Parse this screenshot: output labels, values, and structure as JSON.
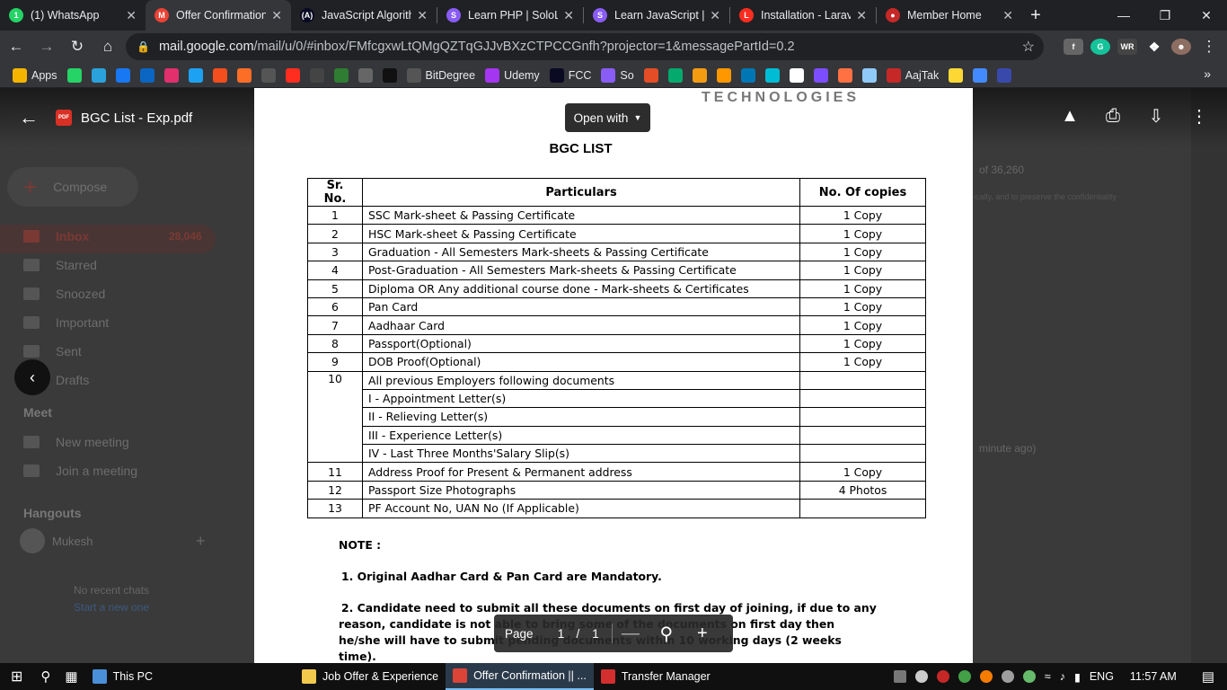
{
  "tabs": [
    {
      "title": "(1) WhatsApp",
      "icon": "whatsapp-icon",
      "color": "#25d366",
      "glyph": "1"
    },
    {
      "title": "Offer Confirmation",
      "icon": "gmail-icon",
      "color": "#ea4335",
      "glyph": "M"
    },
    {
      "title": "JavaScript Algorith",
      "icon": "fcc-icon",
      "color": "#0a0a23",
      "glyph": "(A)"
    },
    {
      "title": "Learn PHP | SoloLe",
      "icon": "sololearn-icon",
      "color": "#8a5cf6",
      "glyph": "S"
    },
    {
      "title": "Learn JavaScript | S",
      "icon": "sololearn-icon",
      "color": "#8a5cf6",
      "glyph": "S"
    },
    {
      "title": "Installation - Larav",
      "icon": "laravel-icon",
      "color": "#ff2d20",
      "glyph": "L"
    },
    {
      "title": "Member Home",
      "icon": "member-icon",
      "color": "#c62828",
      "glyph": "●"
    }
  ],
  "address_bar": {
    "domain": "mail.google.com",
    "path": "/mail/u/0/#inbox/FMfcgxwLtQMgQZTqGJJvBXzCTPCCGnfh?projector=1&messagePartId=0.2"
  },
  "bookmarks": [
    {
      "label": "Apps",
      "icon": "apps-grid-icon",
      "color": "#f4b400"
    },
    {
      "label": "",
      "icon": "whatsapp-icon",
      "color": "#25d366"
    },
    {
      "label": "",
      "icon": "telegram-icon",
      "color": "#2aa1da"
    },
    {
      "label": "",
      "icon": "facebook-icon",
      "color": "#1877f2"
    },
    {
      "label": "",
      "icon": "linkedin-icon",
      "color": "#0a66c2"
    },
    {
      "label": "",
      "icon": "instagram-icon",
      "color": "#e1306c"
    },
    {
      "label": "",
      "icon": "twitter-icon",
      "color": "#1da1f2"
    },
    {
      "label": "",
      "icon": "figma-icon",
      "color": "#f24e1e"
    },
    {
      "label": "",
      "icon": "gitlab-icon",
      "color": "#fc6d26"
    },
    {
      "label": "",
      "icon": "github-icon",
      "color": "#555555"
    },
    {
      "label": "",
      "icon": "laravel-icon",
      "color": "#ff2d20"
    },
    {
      "label": "",
      "icon": "codepen-icon",
      "color": "#444444"
    },
    {
      "label": "",
      "icon": "wix-icon",
      "color": "#2e7d32"
    },
    {
      "label": "",
      "icon": "cc-icon",
      "color": "#666666"
    },
    {
      "label": "",
      "icon": "hashnode-icon",
      "color": "#111111"
    },
    {
      "label": "BitDegree",
      "icon": "bitdegree-icon",
      "color": "#555555"
    },
    {
      "label": "Udemy",
      "icon": "udemy-icon",
      "color": "#a435f0"
    },
    {
      "label": "FCC",
      "icon": "fcc-icon",
      "color": "#0a0a23"
    },
    {
      "label": "So",
      "icon": "sololearn-icon",
      "color": "#8a5cf6"
    },
    {
      "label": "",
      "icon": "w-icon",
      "color": "#e44d26"
    },
    {
      "label": "",
      "icon": "w3-icon",
      "color": "#04aa6d"
    },
    {
      "label": "",
      "icon": "diamond-icon",
      "color": "#f39c12"
    },
    {
      "label": "",
      "icon": "g-icon",
      "color": "#ff9800"
    },
    {
      "label": "",
      "icon": "in-icon",
      "color": "#0077b5"
    },
    {
      "label": "",
      "icon": "swirl-icon",
      "color": "#00bcd4"
    },
    {
      "label": "",
      "icon": "globe-icon",
      "color": "#ffffff"
    },
    {
      "label": "",
      "icon": "hex-icon",
      "color": "#7c4dff"
    },
    {
      "label": "",
      "icon": "box-icon",
      "color": "#ff7043"
    },
    {
      "label": "",
      "icon": "moon-icon",
      "color": "#90caf9"
    },
    {
      "label": "AajTak",
      "icon": "aajtak-icon",
      "color": "#c62828"
    },
    {
      "label": "",
      "icon": "check-icon",
      "color": "#fdd835"
    },
    {
      "label": "",
      "icon": "play-icon",
      "color": "#448aff"
    },
    {
      "label": "",
      "icon": "bh-icon",
      "color": "#3949ab"
    }
  ],
  "gmail": {
    "compose": "Compose",
    "inbox": "Inbox",
    "inbox_count": "28,046",
    "nav": [
      "Starred",
      "Snoozed",
      "Important",
      "Sent",
      "Drafts"
    ],
    "meet_heading": "Meet",
    "meet": [
      "New meeting",
      "Join a meeting"
    ],
    "hangouts_heading": "Hangouts",
    "user": "Mukesh",
    "no_chats": "No recent chats",
    "start_chat": "Start a new one",
    "counter": "of 36,260",
    "time_ago": "minute ago)",
    "confidential": "ically, and to preserve the confidentiality"
  },
  "viewer": {
    "file_name": "BGC List - Exp.pdf",
    "open_with": "Open with",
    "page_label": "Page",
    "page_current": "1",
    "page_sep": "/",
    "page_total": "1"
  },
  "document": {
    "logo_text": "TECHNOLOGIES",
    "title": "BGC LIST",
    "headers": [
      "Sr. No.",
      "Particulars",
      "No. Of copies"
    ],
    "rows": [
      [
        "1",
        "SSC Mark-sheet & Passing Certificate",
        "1 Copy"
      ],
      [
        "2",
        "HSC Mark-sheet & Passing Certificate",
        "1 Copy"
      ],
      [
        "3",
        "Graduation - All Semesters Mark-sheets & Passing Certificate",
        "1 Copy"
      ],
      [
        "4",
        "Post-Graduation - All Semesters Mark-sheets & Passing Certificate",
        "1 Copy"
      ],
      [
        "5",
        "Diploma OR Any additional course done - Mark-sheets & Certificates",
        "1 Copy"
      ],
      [
        "6",
        "Pan Card",
        "1 Copy"
      ],
      [
        "7",
        "Aadhaar Card",
        "1 Copy"
      ],
      [
        "8",
        "Passport(Optional)",
        "1 Copy"
      ],
      [
        "9",
        "DOB Proof(Optional)",
        "1 Copy"
      ]
    ],
    "row10": {
      "num": "10",
      "items": [
        "All previous Employers following documents",
        "I  -  Appointment Letter(s)",
        "II -  Relieving Letter(s)",
        "III - Experience Letter(s)",
        "IV - Last Three Months'Salary Slip(s)"
      ]
    },
    "rows_after": [
      [
        "11",
        "Address Proof for Present & Permanent address",
        "1 Copy"
      ],
      [
        "12",
        "Passport Size Photographs",
        "4 Photos"
      ],
      [
        "13",
        "PF Account No, UAN No (If Applicable)",
        ""
      ]
    ],
    "note_heading": "NOTE :",
    "note1": "1. Original Aadhar Card & Pan Card are Mandatory.",
    "note2": "2. Candidate need to submit all these documents on first day of joining, if due to any reason, candidate is not able to bring some of the documents on first day then he/she will have to submit pending documents within 10 working days (2 weeks time)."
  },
  "taskbar": {
    "apps": [
      {
        "label": "This PC",
        "icon": "this-pc-icon",
        "color": "#4a90d9"
      },
      {
        "label": "Job Offer & Experience",
        "icon": "folder-icon",
        "color": "#f2c94c"
      },
      {
        "label": "Offer Confirmation || ...",
        "icon": "chrome-icon",
        "color": "#db4437"
      },
      {
        "label": "Transfer Manager",
        "icon": "transfer-manager-icon",
        "color": "#d32f2f"
      }
    ],
    "language": "ENG",
    "time": "11:57 AM"
  }
}
